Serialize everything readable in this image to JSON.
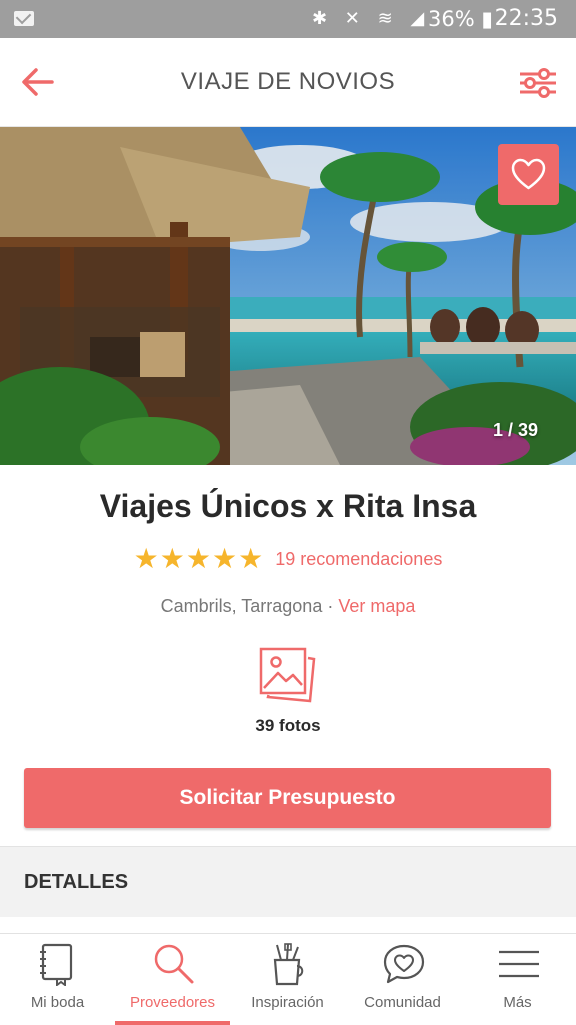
{
  "status_bar": {
    "icons": "✱ ✕ ≋ ◢",
    "battery": "36% ▮",
    "time": "22:35"
  },
  "header": {
    "title": "VIAJE DE NOVIOS",
    "back_icon": "arrow-left-icon",
    "filter_icon": "sliders-icon"
  },
  "gallery": {
    "counter": "1 / 39",
    "favorite_icon": "heart-icon"
  },
  "vendor": {
    "name": "Viajes Únicos x Rita Insa",
    "rating_stars": 5,
    "star_glyph": "★",
    "recommendations": "19 recomendaciones",
    "location": "Cambrils, Tarragona",
    "separator": " · ",
    "map_link": "Ver mapa",
    "photos_count": "39 fotos"
  },
  "cta": {
    "label": "Solicitar Presupuesto"
  },
  "details": {
    "heading": "DETALLES"
  },
  "tabbar": {
    "tabs": [
      {
        "label": "Mi boda",
        "icon": "notebook-icon"
      },
      {
        "label": "Proveedores",
        "icon": "search-icon"
      },
      {
        "label": "Inspiración",
        "icon": "brush-jar-icon"
      },
      {
        "label": "Comunidad",
        "icon": "chat-heart-icon"
      },
      {
        "label": "Más",
        "icon": "menu-icon"
      }
    ],
    "active_index": 1
  },
  "colors": {
    "accent": "#ef6a6a",
    "star": "#f6b52c",
    "status_bar": "#9e9e9e"
  }
}
